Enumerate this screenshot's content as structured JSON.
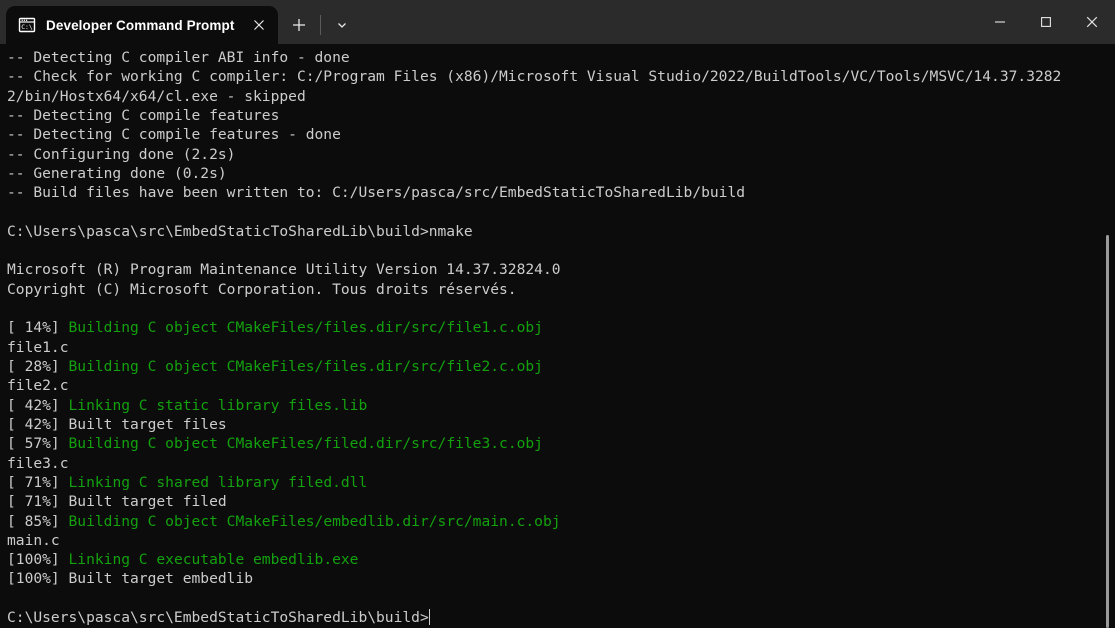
{
  "window": {
    "minimize_label": "Minimize",
    "maximize_label": "Maximize",
    "close_label": "Close",
    "minimize_icon": "minimize-icon",
    "maximize_icon": "maximize-icon",
    "close_icon": "close-icon"
  },
  "tabbar": {
    "tabs": [
      {
        "title": "Developer Command Prompt",
        "icon": "command-prompt-icon",
        "close_icon": "close-icon",
        "active": true
      }
    ],
    "new_tab_icon": "plus-icon",
    "dropdown_icon": "chevron-down-icon"
  },
  "terminal": {
    "background": "#0c0c0c",
    "foreground": "#cccccc",
    "green": "#13a10e",
    "prompt_path": "C:\\Users\\pasca\\src\\EmbedStaticToSharedLib\\build>",
    "cursor": "|",
    "lines": [
      {
        "segments": [
          {
            "text": "-- Detecting C compiler ABI info - done",
            "color": "w"
          }
        ]
      },
      {
        "segments": [
          {
            "text": "-- Check for working C compiler: C:/Program Files (x86)/Microsoft Visual Studio/2022/BuildTools/VC/Tools/MSVC/14.37.3282",
            "color": "w"
          }
        ]
      },
      {
        "segments": [
          {
            "text": "2/bin/Hostx64/x64/cl.exe - skipped",
            "color": "w"
          }
        ]
      },
      {
        "segments": [
          {
            "text": "-- Detecting C compile features",
            "color": "w"
          }
        ]
      },
      {
        "segments": [
          {
            "text": "-- Detecting C compile features - done",
            "color": "w"
          }
        ]
      },
      {
        "segments": [
          {
            "text": "-- Configuring done (2.2s)",
            "color": "w"
          }
        ]
      },
      {
        "segments": [
          {
            "text": "-- Generating done (0.2s)",
            "color": "w"
          }
        ]
      },
      {
        "segments": [
          {
            "text": "-- Build files have been written to: C:/Users/pasca/src/EmbedStaticToSharedLib/build",
            "color": "w"
          }
        ]
      },
      {
        "segments": [
          {
            "text": "",
            "color": "w"
          }
        ]
      },
      {
        "segments": [
          {
            "text": "C:\\Users\\pasca\\src\\EmbedStaticToSharedLib\\build>nmake",
            "color": "w"
          }
        ]
      },
      {
        "segments": [
          {
            "text": "",
            "color": "w"
          }
        ]
      },
      {
        "segments": [
          {
            "text": "Microsoft (R) Program Maintenance Utility Version 14.37.32824.0",
            "color": "w"
          }
        ]
      },
      {
        "segments": [
          {
            "text": "Copyright (C) Microsoft Corporation. Tous droits réservés.",
            "color": "w"
          }
        ]
      },
      {
        "segments": [
          {
            "text": "",
            "color": "w"
          }
        ]
      },
      {
        "segments": [
          {
            "text": "[ 14%] ",
            "color": "w"
          },
          {
            "text": "Building C object CMakeFiles/files.dir/src/file1.c.obj",
            "color": "g"
          }
        ]
      },
      {
        "segments": [
          {
            "text": "file1.c",
            "color": "w"
          }
        ]
      },
      {
        "segments": [
          {
            "text": "[ 28%] ",
            "color": "w"
          },
          {
            "text": "Building C object CMakeFiles/files.dir/src/file2.c.obj",
            "color": "g"
          }
        ]
      },
      {
        "segments": [
          {
            "text": "file2.c",
            "color": "w"
          }
        ]
      },
      {
        "segments": [
          {
            "text": "[ 42%] ",
            "color": "w"
          },
          {
            "text": "Linking C static library files.lib",
            "color": "g"
          }
        ]
      },
      {
        "segments": [
          {
            "text": "[ 42%] Built target files",
            "color": "w"
          }
        ]
      },
      {
        "segments": [
          {
            "text": "[ 57%] ",
            "color": "w"
          },
          {
            "text": "Building C object CMakeFiles/filed.dir/src/file3.c.obj",
            "color": "g"
          }
        ]
      },
      {
        "segments": [
          {
            "text": "file3.c",
            "color": "w"
          }
        ]
      },
      {
        "segments": [
          {
            "text": "[ 71%] ",
            "color": "w"
          },
          {
            "text": "Linking C shared library filed.dll",
            "color": "g"
          }
        ]
      },
      {
        "segments": [
          {
            "text": "[ 71%] Built target filed",
            "color": "w"
          }
        ]
      },
      {
        "segments": [
          {
            "text": "[ 85%] ",
            "color": "w"
          },
          {
            "text": "Building C object CMakeFiles/embedlib.dir/src/main.c.obj",
            "color": "g"
          }
        ]
      },
      {
        "segments": [
          {
            "text": "main.c",
            "color": "w"
          }
        ]
      },
      {
        "segments": [
          {
            "text": "[100%] ",
            "color": "w"
          },
          {
            "text": "Linking C executable embedlib.exe",
            "color": "g"
          }
        ]
      },
      {
        "segments": [
          {
            "text": "[100%] Built target embedlib",
            "color": "w"
          }
        ]
      },
      {
        "segments": [
          {
            "text": "",
            "color": "w"
          }
        ]
      },
      {
        "segments": [
          {
            "text": "C:\\Users\\pasca\\src\\EmbedStaticToSharedLib\\build>",
            "color": "w"
          },
          {
            "text": "",
            "color": "cursor"
          }
        ]
      }
    ]
  },
  "scrollbar": {
    "name": "vertical-scrollbar"
  }
}
